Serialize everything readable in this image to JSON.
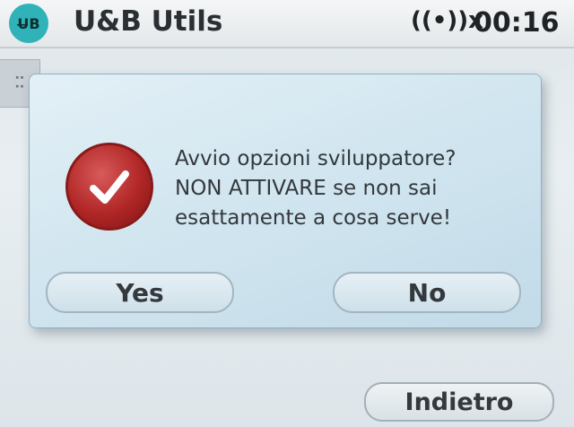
{
  "statusbar": {
    "app_icon_label": "U̶B",
    "app_title": "U&B Utils",
    "signal_icon": "((•))x",
    "clock": "00:16"
  },
  "side_tab": {
    "icon": "⠭"
  },
  "dialog": {
    "message_lines": [
      "Avvio opzioni sviluppatore?",
      "NON ATTIVARE se non sai",
      "esattamente a cosa serve!"
    ],
    "yes_label": "Yes",
    "no_label": "No"
  },
  "footer": {
    "back_label": "Indietro"
  },
  "colors": {
    "accent_red": "#b02626",
    "dialog_bg": "#d2e6f0"
  }
}
